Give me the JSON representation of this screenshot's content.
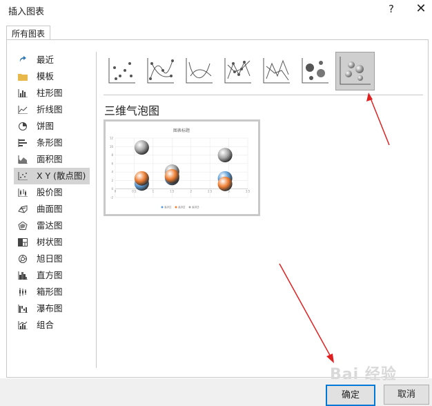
{
  "window": {
    "title": "插入图表",
    "help_label": "?",
    "close_label": "✕"
  },
  "tabs": [
    {
      "label": "所有图表"
    }
  ],
  "sidebar": {
    "items": [
      {
        "label": "最近",
        "icon": "recent-icon"
      },
      {
        "label": "模板",
        "icon": "folder-icon"
      },
      {
        "label": "柱形图",
        "icon": "column-chart-icon"
      },
      {
        "label": "折线图",
        "icon": "line-chart-icon"
      },
      {
        "label": "饼图",
        "icon": "pie-chart-icon"
      },
      {
        "label": "条形图",
        "icon": "bar-chart-icon"
      },
      {
        "label": "面积图",
        "icon": "area-chart-icon"
      },
      {
        "label": "X Y (散点图)",
        "icon": "scatter-chart-icon",
        "selected": true
      },
      {
        "label": "股价图",
        "icon": "stock-chart-icon"
      },
      {
        "label": "曲面图",
        "icon": "surface-chart-icon"
      },
      {
        "label": "雷达图",
        "icon": "radar-chart-icon"
      },
      {
        "label": "树状图",
        "icon": "treemap-chart-icon"
      },
      {
        "label": "旭日图",
        "icon": "sunburst-chart-icon"
      },
      {
        "label": "直方图",
        "icon": "histogram-chart-icon"
      },
      {
        "label": "箱形图",
        "icon": "box-whisker-chart-icon"
      },
      {
        "label": "瀑布图",
        "icon": "waterfall-chart-icon"
      },
      {
        "label": "组合",
        "icon": "combo-chart-icon"
      }
    ]
  },
  "subtypes": [
    {
      "icon": "scatter-icon"
    },
    {
      "icon": "scatter-smooth-lines-markers-icon"
    },
    {
      "icon": "scatter-smooth-lines-icon"
    },
    {
      "icon": "scatter-straight-lines-markers-icon"
    },
    {
      "icon": "scatter-straight-lines-icon"
    },
    {
      "icon": "bubble-icon"
    },
    {
      "icon": "3d-bubble-icon",
      "selected": true
    }
  ],
  "selected_chart_name": "三维气泡图",
  "preview": {
    "chart_data": {
      "type": "scatter",
      "title": "图表标题",
      "x_ticks": [
        "0",
        "0.5",
        "1",
        "1.5",
        "2",
        "2.5",
        "3",
        "3.5"
      ],
      "y_ticks": [
        "-2",
        "0",
        "2",
        "4",
        "6",
        "8",
        "10",
        "12"
      ],
      "xlim": [
        0,
        3.5
      ],
      "ylim": [
        -2,
        12
      ],
      "series": [
        {
          "name": "系列1",
          "color": "#5b9bd5",
          "points": [
            [
              0.7,
              1.3
            ],
            [
              1.5,
              2.6
            ],
            [
              2.9,
              2.5
            ]
          ]
        },
        {
          "name": "系列2",
          "color": "#ed7d31",
          "points": [
            [
              0.7,
              2.5
            ],
            [
              1.5,
              3.0
            ],
            [
              2.9,
              1.2
            ]
          ]
        },
        {
          "name": "系列3",
          "color": "#a5a5a5",
          "points": [
            [
              0.7,
              9.8
            ],
            [
              1.5,
              4.1
            ],
            [
              2.9,
              8.0
            ]
          ]
        }
      ],
      "legend": "bottom",
      "grid": true
    }
  },
  "buttons": {
    "ok": "确定",
    "cancel": "取消"
  },
  "watermark": "Bai 经验",
  "colors": {
    "accent": "#0078d7",
    "selected_bg": "#d4d4d4",
    "arrow": "#e02020"
  }
}
